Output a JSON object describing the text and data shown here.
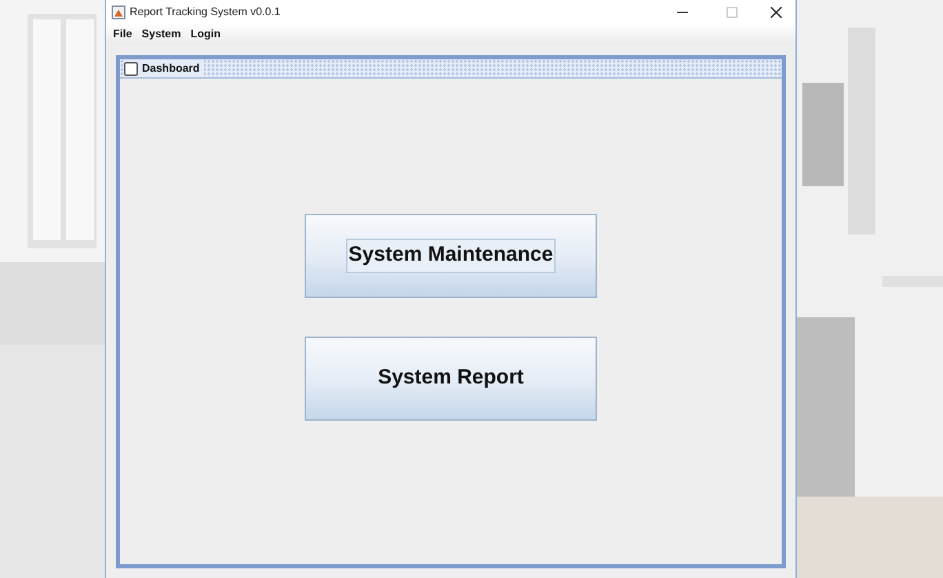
{
  "window": {
    "title": "Report Tracking System v0.0.1"
  },
  "menu": [
    "File",
    "System",
    "Login"
  ],
  "internal_frame": {
    "title": "Dashboard"
  },
  "buttons": [
    {
      "label": "System Maintenance",
      "focused": true
    },
    {
      "label": "System Report",
      "focused": false
    }
  ]
}
